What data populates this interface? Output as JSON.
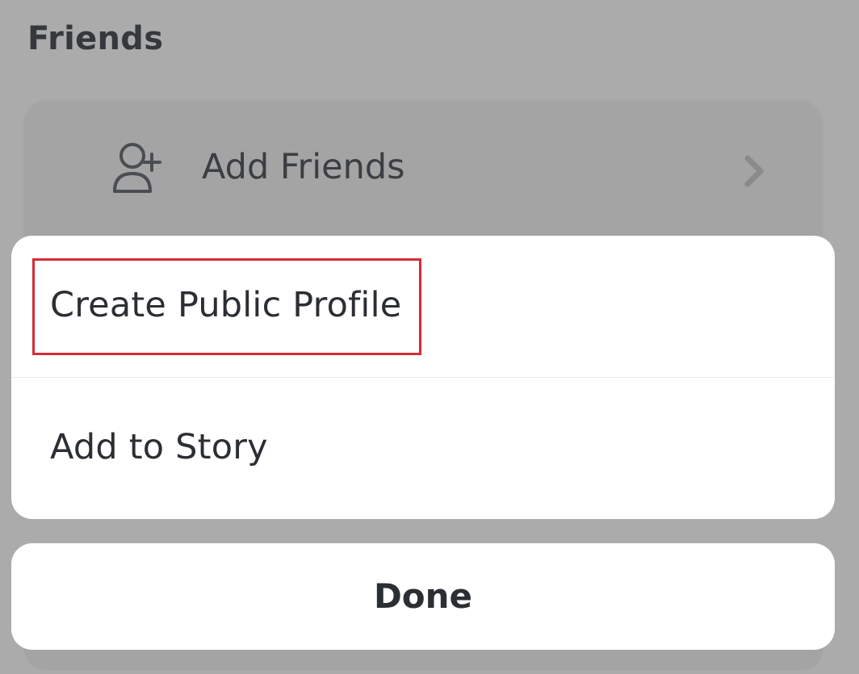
{
  "section": {
    "title": "Friends"
  },
  "friends_card": {
    "add_friends_label": "Add Friends",
    "icon": "add-friend-icon",
    "chevron": "chevron-right-icon"
  },
  "action_sheet": {
    "items": [
      {
        "label": "Create Public Profile",
        "highlighted": true
      },
      {
        "label": "Add to Story",
        "highlighted": false
      }
    ],
    "done_label": "Done"
  },
  "colors": {
    "dim_background": "#ababab",
    "card_background": "#a4a4a4",
    "sheet_background": "#ffffff",
    "text": "#2b2e33",
    "highlight": "#d62b36"
  }
}
